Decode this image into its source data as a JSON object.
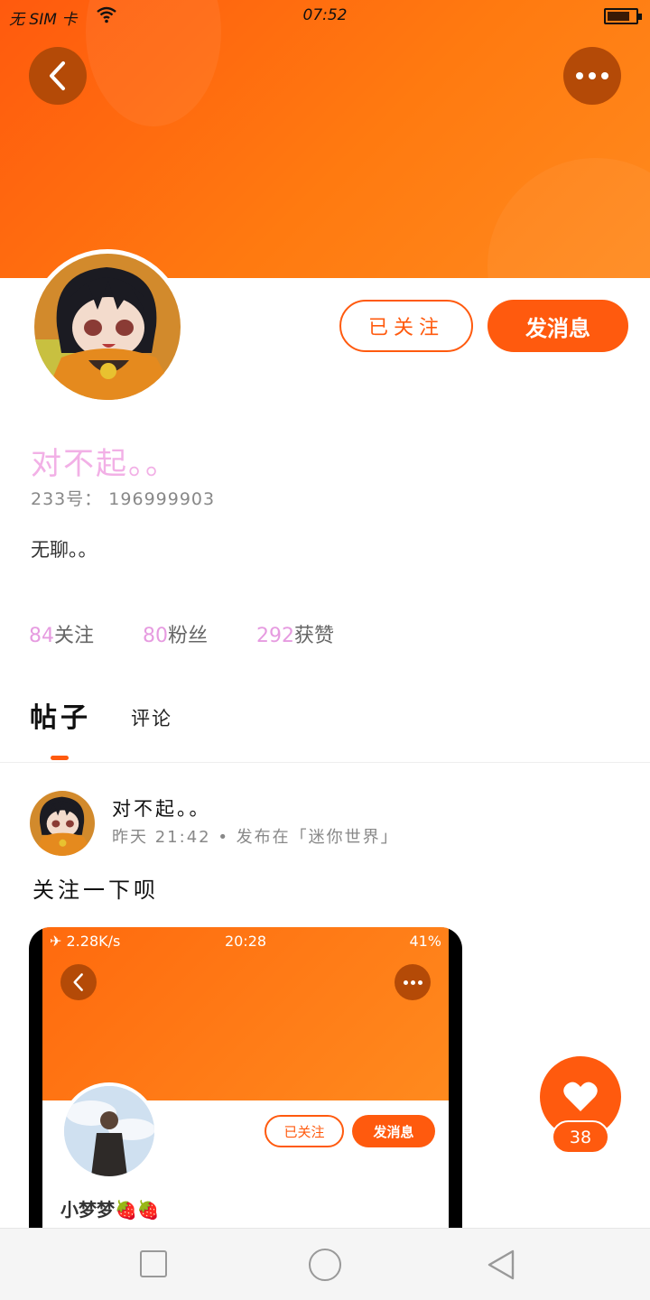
{
  "status_bar": {
    "carrier": "无 SIM 卡",
    "time": "07:52"
  },
  "profile": {
    "username": "对不起。。",
    "user_id": "233号： 196999903",
    "bio": "无聊。。",
    "follow_button": "已关注",
    "message_button": "发消息",
    "stats": [
      {
        "count": "84",
        "label": "关注"
      },
      {
        "count": "80",
        "label": "粉丝"
      },
      {
        "count": "292",
        "label": "获赞"
      }
    ]
  },
  "tabs": [
    {
      "label": "帖子",
      "active": true
    },
    {
      "label": "评论",
      "active": false
    }
  ],
  "post": {
    "author": "对不起。。",
    "meta": "昨天 21:42 • 发布在「迷你世界」",
    "text": "关注一下呗",
    "likes": "38",
    "image": {
      "status_left": "✈ 2.28K/s",
      "status_time": "20:28",
      "status_right": "41%",
      "follow_button": "已关注",
      "message_button": "发消息",
      "username": "小梦梦🍓🍓"
    }
  },
  "colors": {
    "accent": "#ff5a0e",
    "stat_number": "#e69be0",
    "username": "#f2b0e6"
  },
  "icons": [
    "back-icon",
    "more-icon",
    "heart-icon",
    "recents-icon",
    "home-icon",
    "nav-back-icon"
  ]
}
